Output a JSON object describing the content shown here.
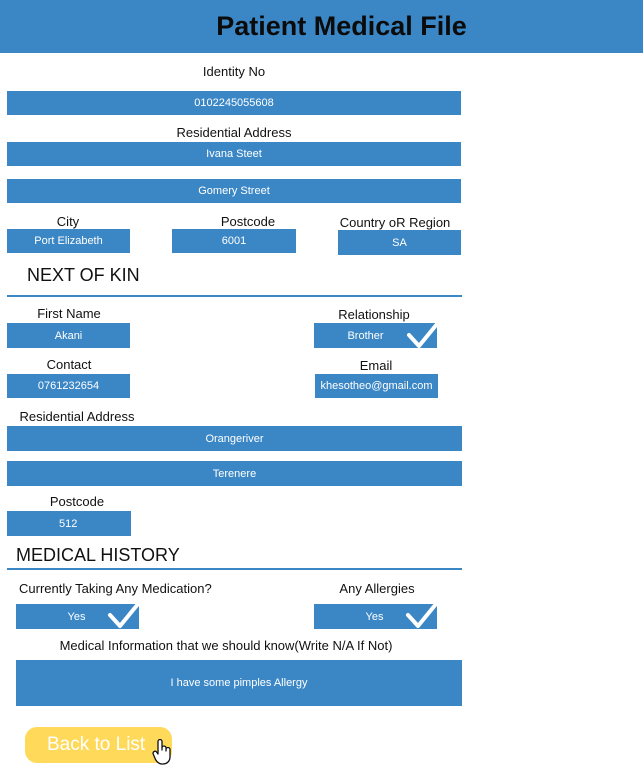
{
  "header": {
    "title": "Patient Medical File"
  },
  "identity": {
    "label": "Identity No",
    "value": "0102245055608"
  },
  "address": {
    "label": "Residential Address",
    "line1": "Ivana Steet",
    "line2": "Gomery Street"
  },
  "location": {
    "city_label": "City",
    "city": "Port Elizabeth",
    "postcode_label": "Postcode",
    "postcode": "6001",
    "country_label": "Country oR Region",
    "country": "SA"
  },
  "next_of_kin": {
    "heading": "NEXT OF KIN",
    "first_name_label": "First Name",
    "first_name": "Akani",
    "relationship_label": "Relationship",
    "relationship": "Brother",
    "contact_label": "Contact",
    "contact": "0761232654",
    "email_label": "Email",
    "email": "khesotheo@gmail.com",
    "address_label": "Residential Address",
    "address_line1": "Orangeriver",
    "address_line2": "Terenere",
    "postcode_label": "Postcode",
    "postcode": "512"
  },
  "medical_history": {
    "heading": "MEDICAL HISTORY",
    "medication_label": "Currently  Taking Any Medication?",
    "medication": "Yes",
    "allergies_label": "Any Allergies",
    "allergies": "Yes",
    "info_label": "Medical Information that we should know(Write N/A If Not)",
    "info": "I have some pimples Allergy"
  },
  "actions": {
    "back_label": "Back to List"
  },
  "colors": {
    "accent": "#3b87c6",
    "button": "#ffd95a"
  },
  "icons": [
    "checkmark-icon",
    "hand-pointer-icon"
  ]
}
